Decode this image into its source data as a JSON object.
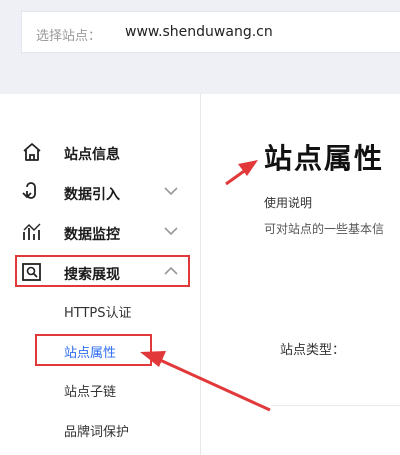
{
  "site_selector": {
    "label": "选择站点：",
    "value": "www.shenduwang.cn"
  },
  "sidebar": {
    "items": [
      {
        "label": "站点信息",
        "icon": "home-icon"
      },
      {
        "label": "数据引入",
        "icon": "data-import-icon",
        "chevron": "chevron-down-icon"
      },
      {
        "label": "数据监控",
        "icon": "monitor-chart-icon",
        "chevron": "chevron-down-icon"
      },
      {
        "label": "搜索展现",
        "icon": "search-display-icon",
        "chevron": "chevron-up-icon"
      }
    ],
    "subitems": [
      {
        "label": "HTTPS认证"
      },
      {
        "label": "站点属性"
      },
      {
        "label": "站点子链"
      },
      {
        "label": "品牌词保护"
      }
    ]
  },
  "main": {
    "title": "站点属性",
    "usage_title": "使用说明",
    "usage_desc": "可对站点的一些基本信",
    "site_type_label": "站点类型："
  },
  "colors": {
    "accent": "#2d6cf0",
    "annotation_red": "#e2383a"
  }
}
